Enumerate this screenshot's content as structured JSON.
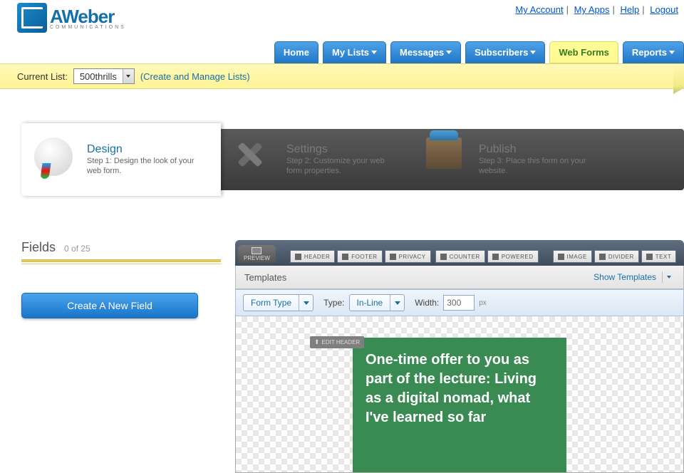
{
  "brand": {
    "name": "AWeber",
    "sub": "COMMUNICATIONS"
  },
  "toplinks": {
    "account": "My Account",
    "apps": "My Apps",
    "help": "Help",
    "logout": "Logout"
  },
  "nav": {
    "home": "Home",
    "lists": "My Lists",
    "messages": "Messages",
    "subscribers": "Subscribers",
    "webforms": "Web Forms",
    "reports": "Reports"
  },
  "listbar": {
    "label": "Current List:",
    "selected": "500thrills",
    "manage": "(Create and Manage Lists)"
  },
  "steps": {
    "design": {
      "title": "Design",
      "desc": "Step 1: Design the look of your web form."
    },
    "settings": {
      "title": "Settings",
      "desc": "Step 2: Customize your web form properties."
    },
    "publish": {
      "title": "Publish",
      "desc": "Step 3: Place this form on your website."
    }
  },
  "fields": {
    "title": "Fields",
    "count": "0 of 25",
    "new_btn": "Create A New Field"
  },
  "toolbar": {
    "preview": "PREVIEW",
    "header": "HEADER",
    "footer": "FOOTER",
    "privacy": "PRIVACY",
    "counter": "COUNTER",
    "powered": "POWERED",
    "image": "IMAGE",
    "divider": "DIVIDER",
    "text": "TEXT"
  },
  "templates": {
    "label": "Templates",
    "show": "Show Templates"
  },
  "form_opts": {
    "form_type_label": "Form Type",
    "type_label": "Type:",
    "type_value": "In-Line",
    "width_label": "Width:",
    "width_value": "300",
    "width_unit": "px"
  },
  "canvas": {
    "edit_header": "EDIT HEADER",
    "headline": "One-time offer to you as part of the lecture: Living as a digital nomad, what I've learned so far"
  }
}
